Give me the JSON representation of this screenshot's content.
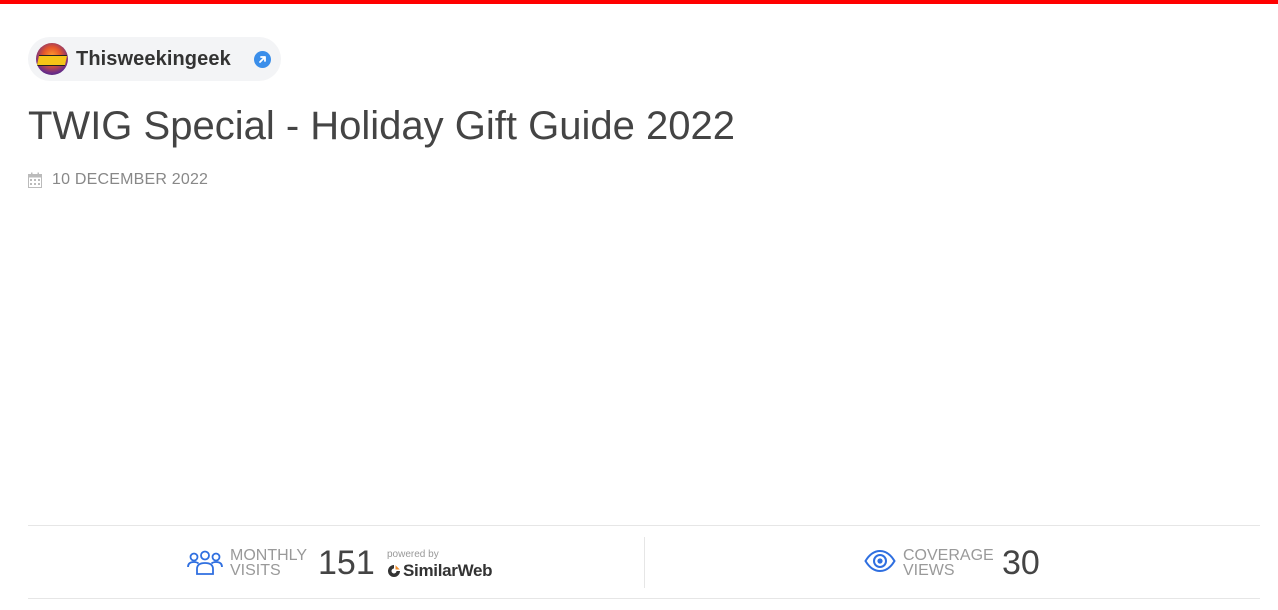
{
  "source": {
    "name": "Thisweekingeek",
    "avatar_icon": "thisweekingeek-logo",
    "link_icon": "external-link-icon"
  },
  "article": {
    "title": "TWIG Special - Holiday Gift Guide 2022",
    "date": "10 DECEMBER 2022",
    "date_icon": "calendar-icon"
  },
  "stats": {
    "monthly_visits": {
      "label_line1": "MONTHLY",
      "label_line2": "VISITS",
      "value": "151",
      "icon": "users-icon"
    },
    "powered_by": {
      "text": "powered by",
      "brand": "SimilarWeb"
    },
    "coverage_views": {
      "label_line1": "COVERAGE",
      "label_line2": "VIEWS",
      "value": "30",
      "icon": "eye-icon"
    }
  },
  "colors": {
    "accent_bar": "#ff0000",
    "link_blue": "#3a8eea",
    "icon_blue": "#2f6fe0"
  }
}
